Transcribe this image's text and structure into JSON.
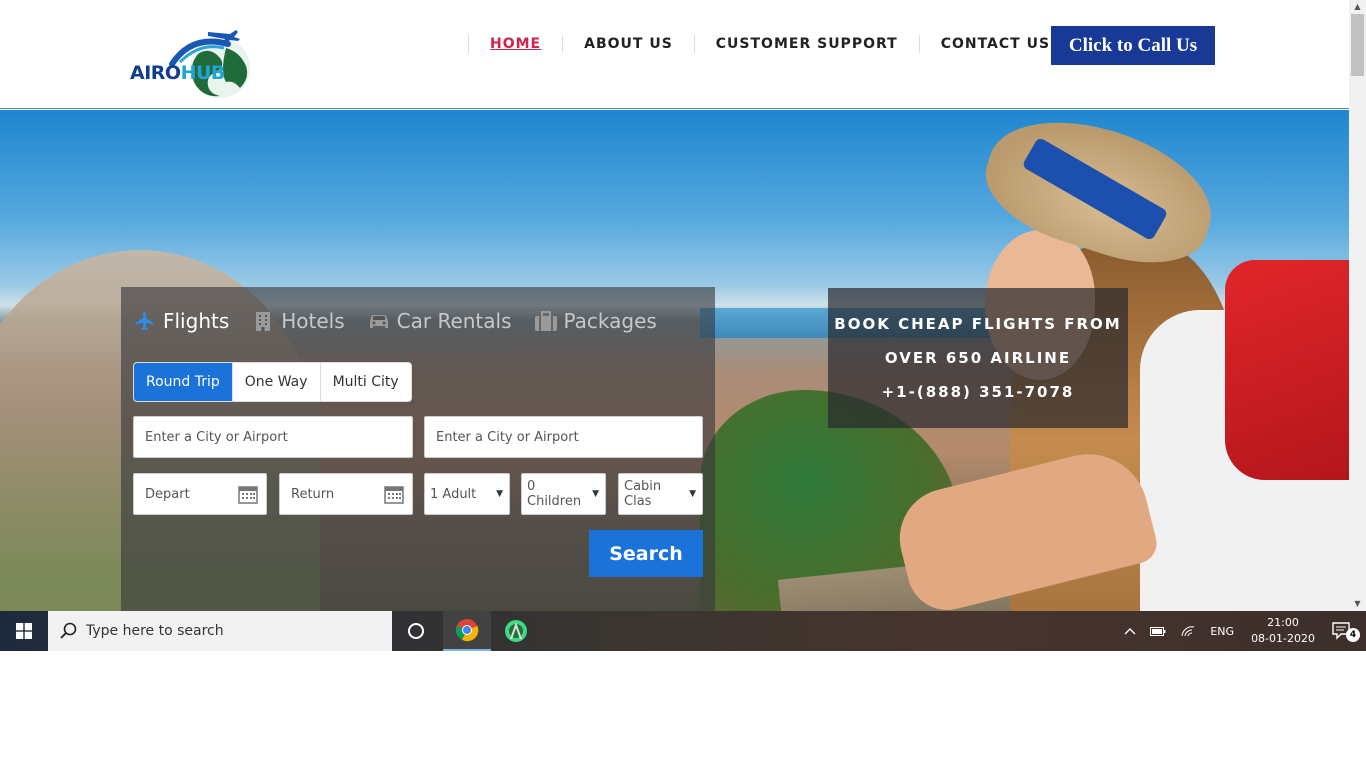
{
  "header": {
    "logo_text_a": "AIRO",
    "logo_text_b": "HUB",
    "nav": [
      "HOME",
      "ABOUT US",
      "CUSTOMER SUPPORT",
      "CONTACT US"
    ],
    "call_button": "Click to Call Us"
  },
  "booking": {
    "product_tabs": [
      "Flights",
      "Hotels",
      "Car Rentals",
      "Packages"
    ],
    "active_product": "Flights",
    "trip_types": [
      "Round Trip",
      "One Way",
      "Multi City"
    ],
    "active_trip": "Round Trip",
    "from_placeholder": "Enter a City or Airport",
    "to_placeholder": "Enter a City or Airport",
    "depart_placeholder": "Depart",
    "return_placeholder": "Return",
    "adults": "1 Adult",
    "children": "0 Children",
    "cabin": "Cabin Clas",
    "search_label": "Search"
  },
  "promo": {
    "line1": "BOOK CHEAP FLIGHTS FROM",
    "line2": "OVER 650 AIRLINE",
    "phone": "+1-(888) 351-7078"
  },
  "taskbar": {
    "search_placeholder": "Type here to search",
    "language": "ENG",
    "time": "21:00",
    "date": "08-01-2020",
    "notification_count": "4"
  },
  "colors": {
    "accent_blue": "#1b72d8",
    "call_button_bg": "#183a96",
    "nav_active": "#d0234d"
  }
}
